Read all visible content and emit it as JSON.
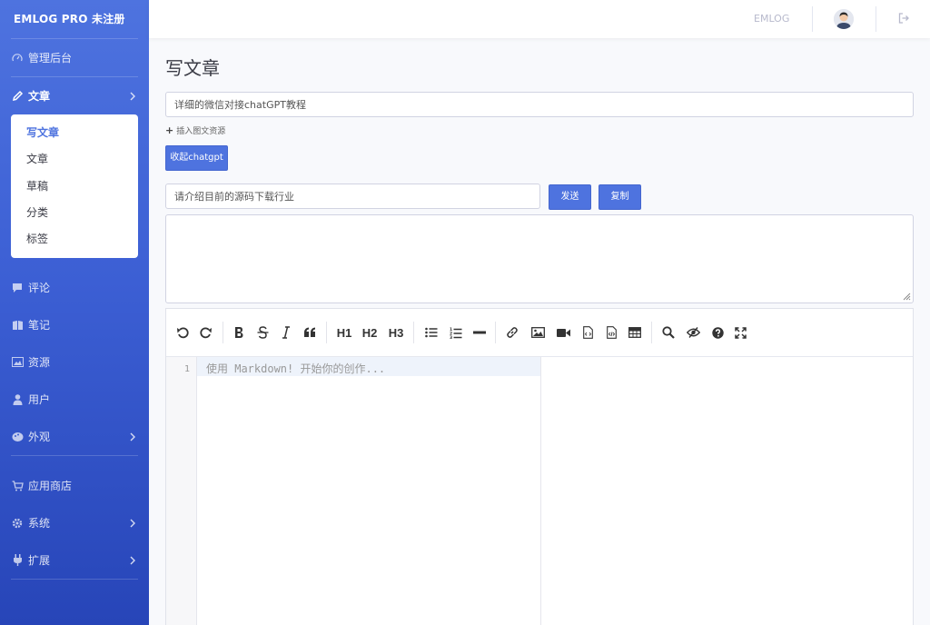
{
  "brand": "EMLOG PRO 未注册",
  "nav": {
    "dashboard": "管理后台",
    "article": "文章",
    "submenu": [
      "写文章",
      "文章",
      "草稿",
      "分类",
      "标签"
    ],
    "comments": "评论",
    "notes": "笔记",
    "resources": "资源",
    "users": "用户",
    "appearance": "外观",
    "store": "应用商店",
    "system": "系统",
    "extensions": "扩展"
  },
  "topbar": {
    "site_name": "EMLOG"
  },
  "page": {
    "title": "写文章",
    "article_title_value": "详细的微信对接chatGPT教程",
    "insert_resource": "插入图文资源",
    "collapse_button": "收起chatgpt",
    "prompt_value": "请介绍目前的源码下载行业",
    "send_button": "发送",
    "copy_button": "复制"
  },
  "editor": {
    "toolbar_text_buttons": [
      "H1",
      "H2",
      "H3"
    ],
    "line_number": "1",
    "placeholder": "使用 Markdown! 开始你的创作..."
  },
  "colors": {
    "accent": "#4e73df",
    "sidebar_dark": "#2745b8"
  }
}
